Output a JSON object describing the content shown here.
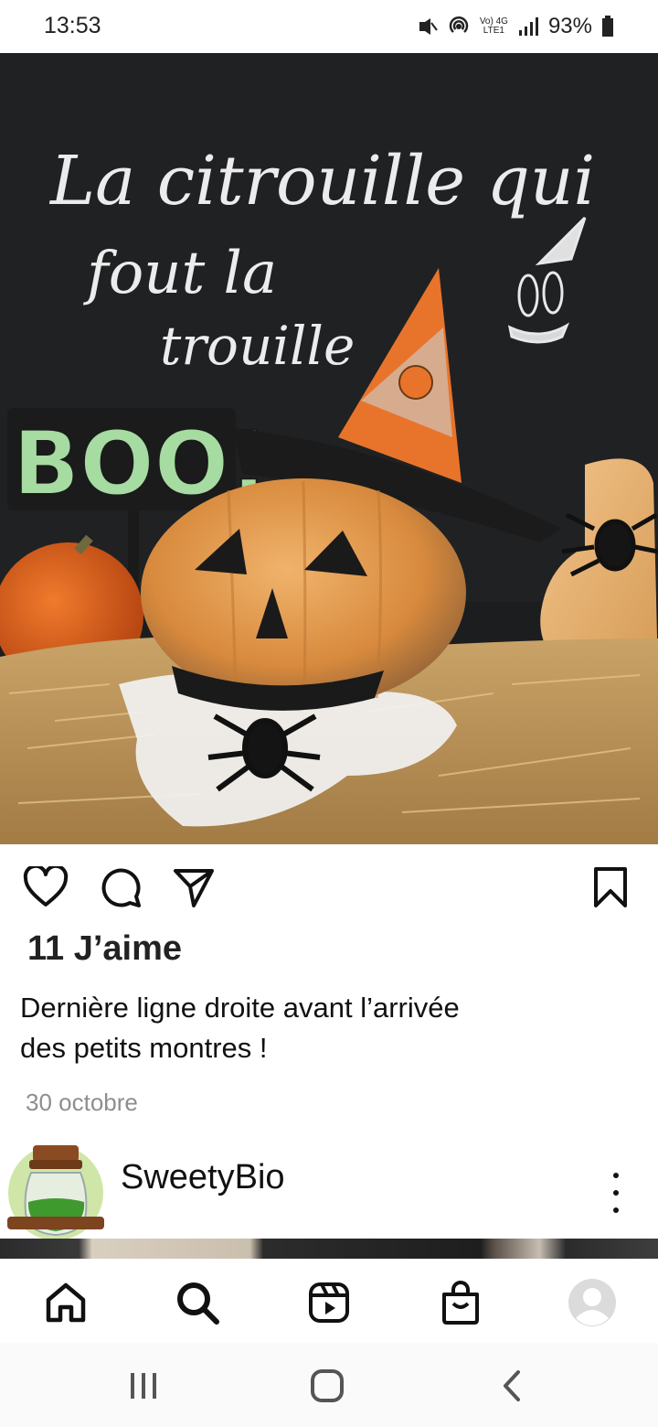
{
  "status_bar": {
    "time": "13:53",
    "battery": "93%",
    "network_top": "Vo) 4G",
    "network_bottom": "LTE1",
    "icons": [
      "mute-vibrate-icon",
      "hotspot-icon",
      "volte-icon",
      "4g-icon",
      "signal-icon",
      "battery-icon"
    ]
  },
  "post": {
    "image_text": {
      "line1": "La citrouille qui",
      "line2": "fout la",
      "line3": "trouille",
      "sign": "BOO!"
    },
    "actions": [
      "heart-icon",
      "comment-icon",
      "share-icon",
      "bookmark-icon"
    ],
    "likes": "11 J’aime",
    "caption_line1": "Dernière ligne droite avant l’arrivée",
    "caption_line2": "des petits montres !",
    "date": "30 octobre"
  },
  "next_post": {
    "username": "SweetyBio"
  },
  "tabbar": {
    "items": [
      "home-icon",
      "search-icon",
      "reels-icon",
      "shop-icon",
      "profile-icon"
    ]
  },
  "system_nav": {
    "items": [
      "recents-icon",
      "home-circle-icon",
      "back-icon"
    ]
  }
}
